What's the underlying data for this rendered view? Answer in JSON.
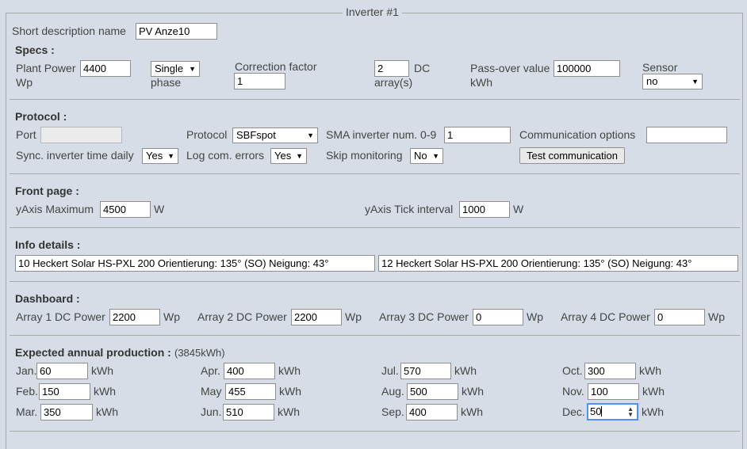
{
  "fieldset_title": "Inverter #1",
  "short_description": {
    "label": "Short description name",
    "value": "PV Anze10"
  },
  "specs": {
    "heading": "Specs :",
    "plant_power": {
      "label": "Plant Power",
      "value": "4400",
      "unit": "Wp"
    },
    "phase": {
      "value": "Single",
      "suffix": "phase"
    },
    "correction_factor": {
      "label": "Correction factor",
      "value": "1"
    },
    "dc_arrays": {
      "value": "2",
      "label_a": "DC",
      "label_b": "array(s)"
    },
    "pass_over": {
      "label": "Pass-over value",
      "value": "100000",
      "unit": "kWh"
    },
    "sensor": {
      "label": "Sensor",
      "value": "no"
    }
  },
  "protocol": {
    "heading": "Protocol :",
    "port_label": "Port",
    "port_value": "",
    "protocol_label": "Protocol",
    "protocol_value": "SBFspot",
    "sma_label": "SMA inverter num. 0-9",
    "sma_value": "1",
    "comm_options_label": "Communication options",
    "comm_options_value": "",
    "sync_label": "Sync. inverter time daily",
    "sync_value": "Yes",
    "log_label": "Log com. errors",
    "log_value": "Yes",
    "skip_label": "Skip monitoring",
    "skip_value": "No",
    "test_button": "Test communication"
  },
  "front_page": {
    "heading": "Front page :",
    "yaxis_max_label": "yAxis Maximum",
    "yaxis_max_value": "4500",
    "yaxis_max_unit": "W",
    "tick_label": "yAxis Tick interval",
    "tick_value": "1000",
    "tick_unit": "W"
  },
  "info_details": {
    "heading": "Info details :",
    "array1": "10 Heckert Solar HS-PXL 200 Orientierung: 135° (SO) Neigung: 43°",
    "array2": "12 Heckert Solar HS-PXL 200 Orientierung: 135° (SO) Neigung: 43°"
  },
  "dashboard": {
    "heading": "Dashboard :",
    "unit": "Wp",
    "arrays": [
      {
        "label": "Array 1 DC Power",
        "value": "2200"
      },
      {
        "label": "Array 2 DC Power",
        "value": "2200"
      },
      {
        "label": "Array 3 DC Power",
        "value": "0"
      },
      {
        "label": "Array 4 DC Power",
        "value": "0"
      }
    ]
  },
  "expected": {
    "heading": "Expected annual production :",
    "total": "(3845kWh)",
    "unit": "kWh",
    "months": [
      {
        "label": "Jan.",
        "value": "60"
      },
      {
        "label": "Feb.",
        "value": "150"
      },
      {
        "label": "Mar.",
        "value": "350"
      },
      {
        "label": "Apr.",
        "value": "400"
      },
      {
        "label": "May",
        "value": "455"
      },
      {
        "label": "Jun.",
        "value": "510"
      },
      {
        "label": "Jul.",
        "value": "570"
      },
      {
        "label": "Aug.",
        "value": "500"
      },
      {
        "label": "Sep.",
        "value": "400"
      },
      {
        "label": "Oct.",
        "value": "300"
      },
      {
        "label": "Nov.",
        "value": "100"
      },
      {
        "label": "Dec.",
        "value": "50"
      }
    ]
  }
}
